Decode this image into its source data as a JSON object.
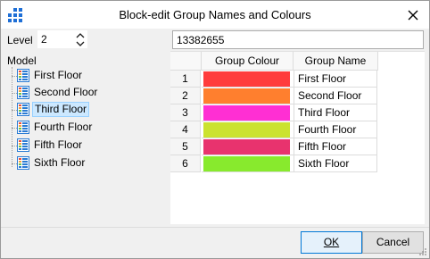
{
  "window": {
    "title": "Block-edit Group Names and Colours",
    "icon": "grid-app-icon",
    "close_icon": "close-icon"
  },
  "level": {
    "label": "Level",
    "value": "2"
  },
  "model": {
    "label": "Model",
    "items": [
      {
        "label": "First Floor",
        "selected": false
      },
      {
        "label": "Second Floor",
        "selected": false
      },
      {
        "label": "Third Floor",
        "selected": true
      },
      {
        "label": "Fourth Floor",
        "selected": false
      },
      {
        "label": "Fifth Floor",
        "selected": false
      },
      {
        "label": "Sixth Floor",
        "selected": false
      }
    ]
  },
  "name_field": {
    "value": "13382655"
  },
  "table": {
    "headers": [
      "",
      "Group Colour",
      "Group Name"
    ],
    "rows": [
      {
        "index": "1",
        "color": "#ff3c3c",
        "name": "First Floor"
      },
      {
        "index": "2",
        "color": "#ff7f2e",
        "name": "Second Floor"
      },
      {
        "index": "3",
        "color": "#ff2fd3",
        "name": "Third Floor"
      },
      {
        "index": "4",
        "color": "#cbe22f",
        "name": "Fourth Floor"
      },
      {
        "index": "5",
        "color": "#e8336e",
        "name": "Fifth Floor"
      },
      {
        "index": "6",
        "color": "#88ea2d",
        "name": "Sixth Floor"
      }
    ]
  },
  "buttons": {
    "ok": "OK",
    "cancel": "Cancel"
  }
}
